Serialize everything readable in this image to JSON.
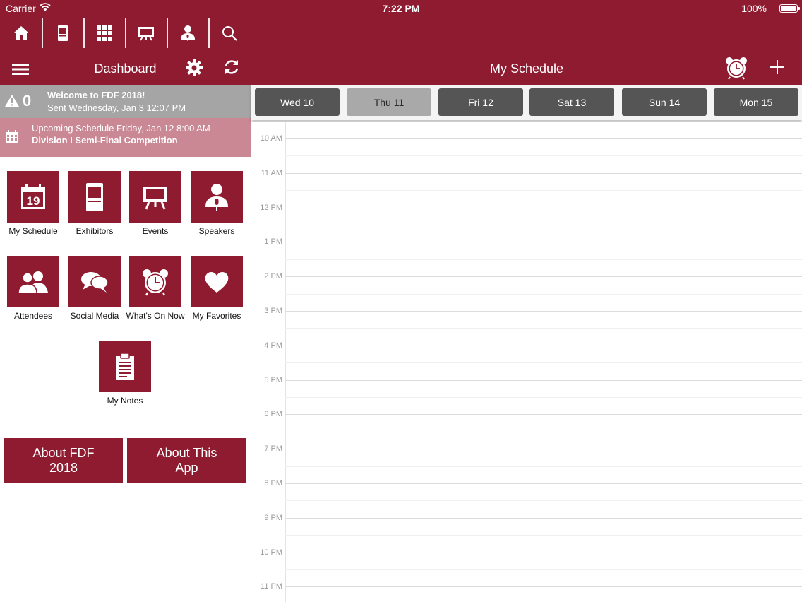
{
  "status_bar": {
    "carrier": "Carrier",
    "time": "7:22 PM",
    "battery": "100%"
  },
  "toolbar": {
    "icons": [
      "home-icon",
      "exhibitor-booth-icon",
      "grid-icon",
      "easel-icon",
      "speaker-icon",
      "search-icon"
    ]
  },
  "left_header": {
    "title": "Dashboard"
  },
  "right_header": {
    "title": "My Schedule"
  },
  "alert": {
    "count": "0",
    "title": "Welcome to FDF 2018!",
    "subtitle": "Sent Wednesday, Jan 3 12:07 PM"
  },
  "upcoming": {
    "title": "Upcoming Schedule Friday, Jan 12 8:00 AM",
    "subtitle": "Division I Semi-Final Competition"
  },
  "tiles": [
    {
      "label": "My Schedule",
      "calendar_day": "19"
    },
    {
      "label": "Exhibitors"
    },
    {
      "label": "Events"
    },
    {
      "label": "Speakers"
    },
    {
      "label": "Attendees"
    },
    {
      "label": "Social Media"
    },
    {
      "label": "What's On Now"
    },
    {
      "label": "My Favorites"
    },
    {
      "label": "My Notes"
    }
  ],
  "about": {
    "fdf": "About FDF 2018",
    "app": "About This App"
  },
  "days": [
    {
      "label": "Wed 10",
      "selected": false
    },
    {
      "label": "Thu 11",
      "selected": true
    },
    {
      "label": "Fri 12",
      "selected": false
    },
    {
      "label": "Sat 13",
      "selected": false
    },
    {
      "label": "Sun 14",
      "selected": false
    },
    {
      "label": "Mon 15",
      "selected": false
    }
  ],
  "hours": [
    "10 AM",
    "11 AM",
    "12 PM",
    "1 PM",
    "2 PM",
    "3 PM",
    "4 PM",
    "5 PM",
    "6 PM",
    "7 PM",
    "8 PM",
    "9 PM",
    "10 PM",
    "11 PM"
  ],
  "colors": {
    "brand": "#8f1b30",
    "alert_bg": "#a5a5a5",
    "upcoming_bg": "#c98893",
    "day_tab": "#555555",
    "day_tab_selected": "#a9a9a9"
  }
}
